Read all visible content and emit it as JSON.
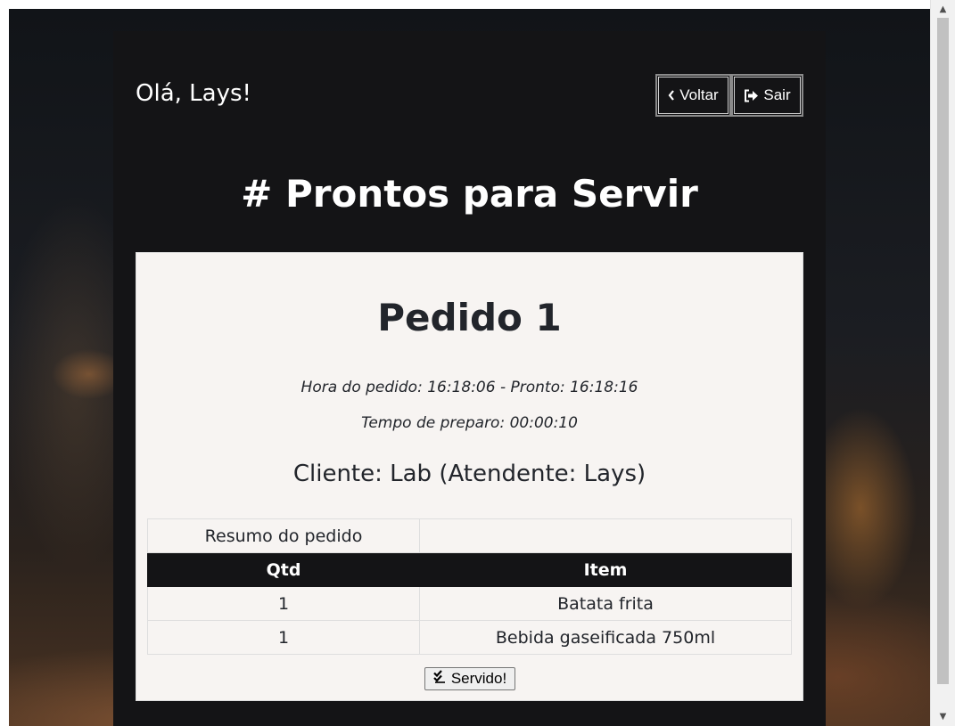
{
  "header": {
    "greeting": "Olá, Lays!",
    "back_label": "Voltar",
    "exit_label": "Sair"
  },
  "section_title": "# Prontos para Servir",
  "order": {
    "title": "Pedido 1",
    "times": "Hora do pedido: 16:18:06 - Pronto: 16:18:16",
    "prep_time": "Tempo de preparo: 00:00:10",
    "client": "Cliente: Lab (Atendente: Lays)",
    "summary_label": "Resumo do pedido",
    "columns": [
      "Qtd",
      "Item"
    ],
    "rows": [
      {
        "qty": "1",
        "item": "Batata frita"
      },
      {
        "qty": "1",
        "item": "Bebida gaseificada 750ml"
      }
    ],
    "served_label": "Servido!"
  },
  "icons": {
    "back": "chevron-left-icon",
    "exit": "sign-out-icon",
    "served": "double-check-icon"
  }
}
